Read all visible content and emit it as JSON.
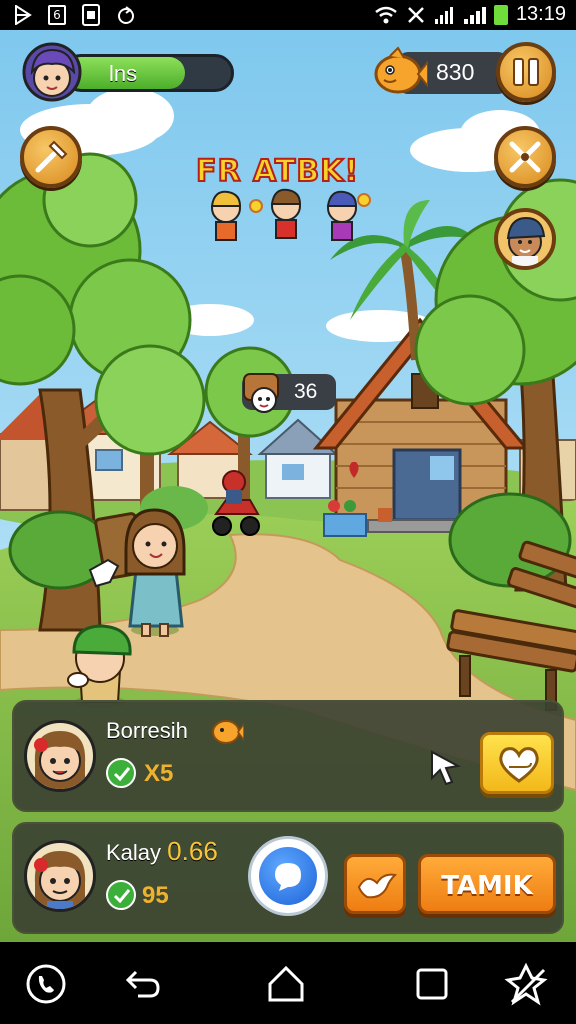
{
  "status_bar": {
    "time": "13:19",
    "badge_count": "6",
    "icons": [
      "play-store-icon",
      "notification-6-icon",
      "sim-icon",
      "sync-icon",
      "wifi-icon",
      "no-signal-icon",
      "signal-icon",
      "battery-icon"
    ]
  },
  "hud": {
    "player_label": "lns",
    "health_fraction": 0.72,
    "coins": "830",
    "colors": {
      "health": "#5cc23a",
      "button": "#e9a83a"
    }
  },
  "scene": {
    "banner_text": "FR ATBK!",
    "bubble_count": "36"
  },
  "panels": [
    {
      "name": "Borresih",
      "multiplier": "X5",
      "action_icon": "heart-hand-icon"
    },
    {
      "name": "Kalay",
      "score": "0.66",
      "count": "95",
      "button_label": "TAMIK"
    }
  ],
  "nav_bar": {
    "icons": [
      "phone-icon",
      "back-icon",
      "home-icon",
      "recents-icon",
      "puzzle-icon"
    ]
  }
}
